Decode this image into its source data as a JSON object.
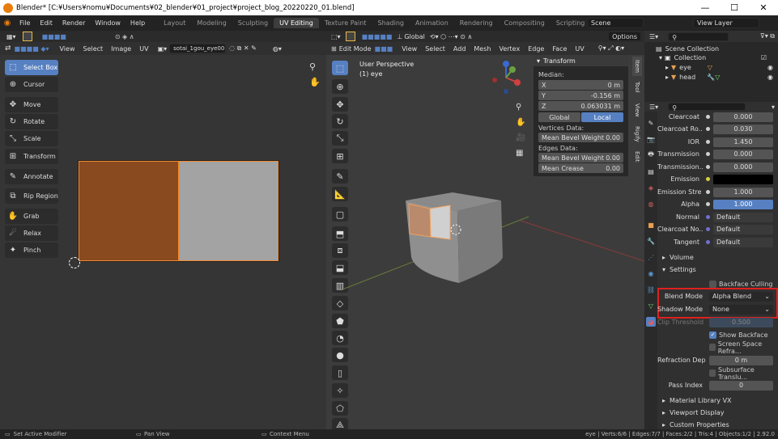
{
  "window": {
    "title": "Blender* [C:¥Users¥nomu¥Documents¥02_blender¥01_project¥project_blog_20220220_01.blend]",
    "minimize": "—",
    "maximize": "☐",
    "close": "✕"
  },
  "menu": [
    "File",
    "Edit",
    "Render",
    "Window",
    "Help"
  ],
  "workspace_tabs": [
    "Layout",
    "Modeling",
    "Sculpting",
    "UV Editing",
    "Texture Paint",
    "Shading",
    "Animation",
    "Rendering",
    "Compositing",
    "Scripting"
  ],
  "active_tab": "UV Editing",
  "scene": "Scene",
  "view_layer": "View Layer",
  "uv_header": {
    "menus": [
      "View",
      "Select",
      "Image",
      "UV"
    ],
    "image_name": "sotai_1gou_eye00"
  },
  "uv_tools": [
    "Select Box",
    "Cursor",
    "Move",
    "Rotate",
    "Scale",
    "Transform",
    "Annotate",
    "Rip Region",
    "Grab",
    "Relax",
    "Pinch"
  ],
  "vp_header": {
    "mode": "Edit Mode",
    "menus": [
      "View",
      "Select",
      "Add",
      "Mesh",
      "Vertex",
      "Edge",
      "Face",
      "UV"
    ],
    "orientation": "Global",
    "options": "Options"
  },
  "viewport": {
    "perspective": "User Perspective",
    "object": "(1) eye"
  },
  "transform": {
    "title": "Transform",
    "median": "Median:",
    "x_label": "X",
    "x": "0 m",
    "y_label": "Y",
    "y": "-0.156 m",
    "z_label": "Z",
    "z": "0.063031 m",
    "global": "Global",
    "local": "Local",
    "vertices_data": "Vertices Data:",
    "edges_data": "Edges Data:",
    "mean_bevel_label": "Mean Bevel Weight",
    "mean_bevel_v": "0.00",
    "mean_bevel_e": "0.00",
    "mean_crease_label": "Mean Crease",
    "mean_crease": "0.00"
  },
  "npanel_tabs": [
    "Item",
    "Tool",
    "View",
    "Rigify",
    "Edit"
  ],
  "outliner": {
    "scene_collection": "Scene Collection",
    "collection": "Collection",
    "items": [
      "eye",
      "head"
    ]
  },
  "props": {
    "rows": [
      [
        "Clearcoat",
        "0.000"
      ],
      [
        "Clearcoat Ro...",
        "0.030"
      ],
      [
        "IOR",
        "1.450"
      ],
      [
        "Transmission",
        "0.000"
      ],
      [
        "Transmission...",
        "0.000"
      ],
      [
        "Emission",
        ""
      ],
      [
        "Emission Stre",
        "1.000"
      ],
      [
        "Alpha",
        "1.000"
      ],
      [
        "Normal",
        "Default"
      ],
      [
        "Clearcoat No...",
        "Default"
      ],
      [
        "Tangent",
        "Default"
      ]
    ],
    "volume": "Volume",
    "settings": "Settings",
    "backface_culling": "Backface Culling",
    "blend_mode_label": "Blend Mode",
    "blend_mode": "Alpha Blend",
    "shadow_mode_label": "Shadow Mode",
    "shadow_mode": "None",
    "clip_threshold_label": "Clip Threshold",
    "clip_threshold": "0.500",
    "show_backface": "Show Backface",
    "ssr": "Screen Space Refra...",
    "refraction_depth_label": "Refraction Dep...",
    "refraction_depth": "0 m",
    "subsurface": "Subsurface Translu...",
    "pass_index_label": "Pass Index",
    "pass_index": "0",
    "material_library": "Material Library VX",
    "viewport_display": "Viewport Display",
    "custom_properties": "Custom Properties"
  },
  "status": {
    "left": "Set Active Modifier",
    "mid": "Pan View",
    "right": "Context Menu",
    "stats": "eye | Verts:6/6 | Edges:7/7 | Faces:2/2 | Tris:4 | Objects:1/2 | 2.92.0"
  },
  "colors": {
    "accent": "#5680c2",
    "highlight": "#e02020",
    "uv_face": "#8a4a20"
  }
}
